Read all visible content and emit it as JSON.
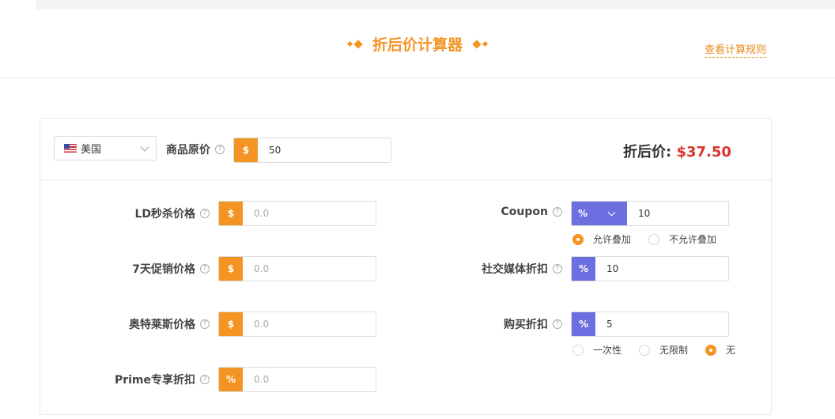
{
  "header": {
    "title": "折后价计算器",
    "rules_link": "查看计算规则"
  },
  "top": {
    "country": "美国",
    "price_label": "商品原价",
    "currency_symbol": "$",
    "price_value": "50",
    "result_label": "折后价:",
    "result_value": "$37.50"
  },
  "left_fields": [
    {
      "label": "LD秒杀价格",
      "prefix": "$",
      "placeholder": "0.0"
    },
    {
      "label": "7天促销价格",
      "prefix": "$",
      "placeholder": "0.0"
    },
    {
      "label": "奥特莱斯价格",
      "prefix": "$",
      "placeholder": "0.0"
    },
    {
      "label": "Prime专享折扣",
      "prefix": "%",
      "placeholder": "0.0"
    }
  ],
  "coupon": {
    "label": "Coupon",
    "type": "%",
    "value": "10",
    "options": [
      "允许叠加",
      "不允许叠加"
    ],
    "selected": "允许叠加"
  },
  "social": {
    "label": "社交媒体折扣",
    "prefix": "%",
    "value": "10"
  },
  "purchase": {
    "label": "购买折扣",
    "prefix": "%",
    "value": "5",
    "options": [
      "一次性",
      "无限制",
      "无"
    ],
    "selected": "无"
  },
  "colors": {
    "accent": "#f39423",
    "blue": "#6c6fe0",
    "price": "#d8342c"
  }
}
